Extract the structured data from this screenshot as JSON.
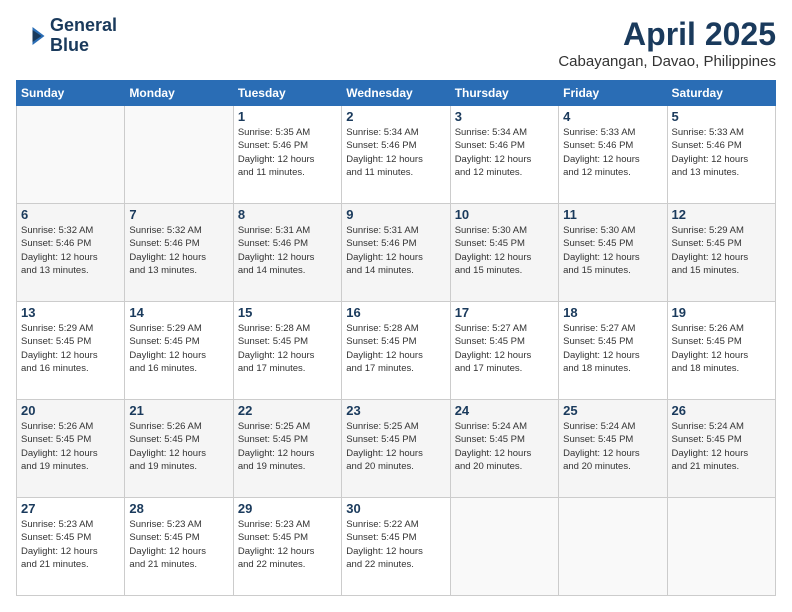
{
  "header": {
    "logo_line1": "General",
    "logo_line2": "Blue",
    "month_title": "April 2025",
    "subtitle": "Cabayangan, Davao, Philippines"
  },
  "weekdays": [
    "Sunday",
    "Monday",
    "Tuesday",
    "Wednesday",
    "Thursday",
    "Friday",
    "Saturday"
  ],
  "weeks": [
    [
      {
        "day": "",
        "detail": ""
      },
      {
        "day": "",
        "detail": ""
      },
      {
        "day": "1",
        "detail": "Sunrise: 5:35 AM\nSunset: 5:46 PM\nDaylight: 12 hours\nand 11 minutes."
      },
      {
        "day": "2",
        "detail": "Sunrise: 5:34 AM\nSunset: 5:46 PM\nDaylight: 12 hours\nand 11 minutes."
      },
      {
        "day": "3",
        "detail": "Sunrise: 5:34 AM\nSunset: 5:46 PM\nDaylight: 12 hours\nand 12 minutes."
      },
      {
        "day": "4",
        "detail": "Sunrise: 5:33 AM\nSunset: 5:46 PM\nDaylight: 12 hours\nand 12 minutes."
      },
      {
        "day": "5",
        "detail": "Sunrise: 5:33 AM\nSunset: 5:46 PM\nDaylight: 12 hours\nand 13 minutes."
      }
    ],
    [
      {
        "day": "6",
        "detail": "Sunrise: 5:32 AM\nSunset: 5:46 PM\nDaylight: 12 hours\nand 13 minutes."
      },
      {
        "day": "7",
        "detail": "Sunrise: 5:32 AM\nSunset: 5:46 PM\nDaylight: 12 hours\nand 13 minutes."
      },
      {
        "day": "8",
        "detail": "Sunrise: 5:31 AM\nSunset: 5:46 PM\nDaylight: 12 hours\nand 14 minutes."
      },
      {
        "day": "9",
        "detail": "Sunrise: 5:31 AM\nSunset: 5:46 PM\nDaylight: 12 hours\nand 14 minutes."
      },
      {
        "day": "10",
        "detail": "Sunrise: 5:30 AM\nSunset: 5:45 PM\nDaylight: 12 hours\nand 15 minutes."
      },
      {
        "day": "11",
        "detail": "Sunrise: 5:30 AM\nSunset: 5:45 PM\nDaylight: 12 hours\nand 15 minutes."
      },
      {
        "day": "12",
        "detail": "Sunrise: 5:29 AM\nSunset: 5:45 PM\nDaylight: 12 hours\nand 15 minutes."
      }
    ],
    [
      {
        "day": "13",
        "detail": "Sunrise: 5:29 AM\nSunset: 5:45 PM\nDaylight: 12 hours\nand 16 minutes."
      },
      {
        "day": "14",
        "detail": "Sunrise: 5:29 AM\nSunset: 5:45 PM\nDaylight: 12 hours\nand 16 minutes."
      },
      {
        "day": "15",
        "detail": "Sunrise: 5:28 AM\nSunset: 5:45 PM\nDaylight: 12 hours\nand 17 minutes."
      },
      {
        "day": "16",
        "detail": "Sunrise: 5:28 AM\nSunset: 5:45 PM\nDaylight: 12 hours\nand 17 minutes."
      },
      {
        "day": "17",
        "detail": "Sunrise: 5:27 AM\nSunset: 5:45 PM\nDaylight: 12 hours\nand 17 minutes."
      },
      {
        "day": "18",
        "detail": "Sunrise: 5:27 AM\nSunset: 5:45 PM\nDaylight: 12 hours\nand 18 minutes."
      },
      {
        "day": "19",
        "detail": "Sunrise: 5:26 AM\nSunset: 5:45 PM\nDaylight: 12 hours\nand 18 minutes."
      }
    ],
    [
      {
        "day": "20",
        "detail": "Sunrise: 5:26 AM\nSunset: 5:45 PM\nDaylight: 12 hours\nand 19 minutes."
      },
      {
        "day": "21",
        "detail": "Sunrise: 5:26 AM\nSunset: 5:45 PM\nDaylight: 12 hours\nand 19 minutes."
      },
      {
        "day": "22",
        "detail": "Sunrise: 5:25 AM\nSunset: 5:45 PM\nDaylight: 12 hours\nand 19 minutes."
      },
      {
        "day": "23",
        "detail": "Sunrise: 5:25 AM\nSunset: 5:45 PM\nDaylight: 12 hours\nand 20 minutes."
      },
      {
        "day": "24",
        "detail": "Sunrise: 5:24 AM\nSunset: 5:45 PM\nDaylight: 12 hours\nand 20 minutes."
      },
      {
        "day": "25",
        "detail": "Sunrise: 5:24 AM\nSunset: 5:45 PM\nDaylight: 12 hours\nand 20 minutes."
      },
      {
        "day": "26",
        "detail": "Sunrise: 5:24 AM\nSunset: 5:45 PM\nDaylight: 12 hours\nand 21 minutes."
      }
    ],
    [
      {
        "day": "27",
        "detail": "Sunrise: 5:23 AM\nSunset: 5:45 PM\nDaylight: 12 hours\nand 21 minutes."
      },
      {
        "day": "28",
        "detail": "Sunrise: 5:23 AM\nSunset: 5:45 PM\nDaylight: 12 hours\nand 21 minutes."
      },
      {
        "day": "29",
        "detail": "Sunrise: 5:23 AM\nSunset: 5:45 PM\nDaylight: 12 hours\nand 22 minutes."
      },
      {
        "day": "30",
        "detail": "Sunrise: 5:22 AM\nSunset: 5:45 PM\nDaylight: 12 hours\nand 22 minutes."
      },
      {
        "day": "",
        "detail": ""
      },
      {
        "day": "",
        "detail": ""
      },
      {
        "day": "",
        "detail": ""
      }
    ]
  ]
}
